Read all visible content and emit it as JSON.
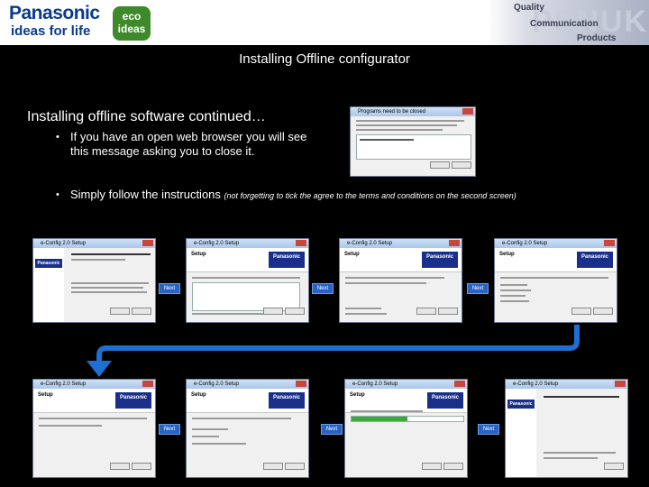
{
  "header": {
    "brand": "Panasonic",
    "tagline": "ideas for life",
    "eco_badge": "eco\nideas",
    "partner_logo": "PSNUK",
    "partner_lines": [
      "Quality",
      "Communication",
      "Products"
    ]
  },
  "slide_title": "Installing Offline configurator",
  "section_heading": "Installing offline software continued…",
  "bullets": [
    "If you have an open web browser you will see this message asking you to close it.",
    "Simply follow the instructions"
  ],
  "bullet_2_note": "(not forgetting to tick the agree to the terms and conditions on the second screen)",
  "bullet_marker": "•",
  "screenshots": {
    "browser_prompt_title": "Programs need to be closed",
    "wizard_title": "e-Config 2.0 Setup",
    "brand_logo": "Panasonic",
    "next_label": "Next"
  },
  "colors": {
    "background": "#000000",
    "brand_blue": "#0a3a8c",
    "eco_green": "#3e8a2a",
    "arrow_blue": "#1e6fd1"
  }
}
